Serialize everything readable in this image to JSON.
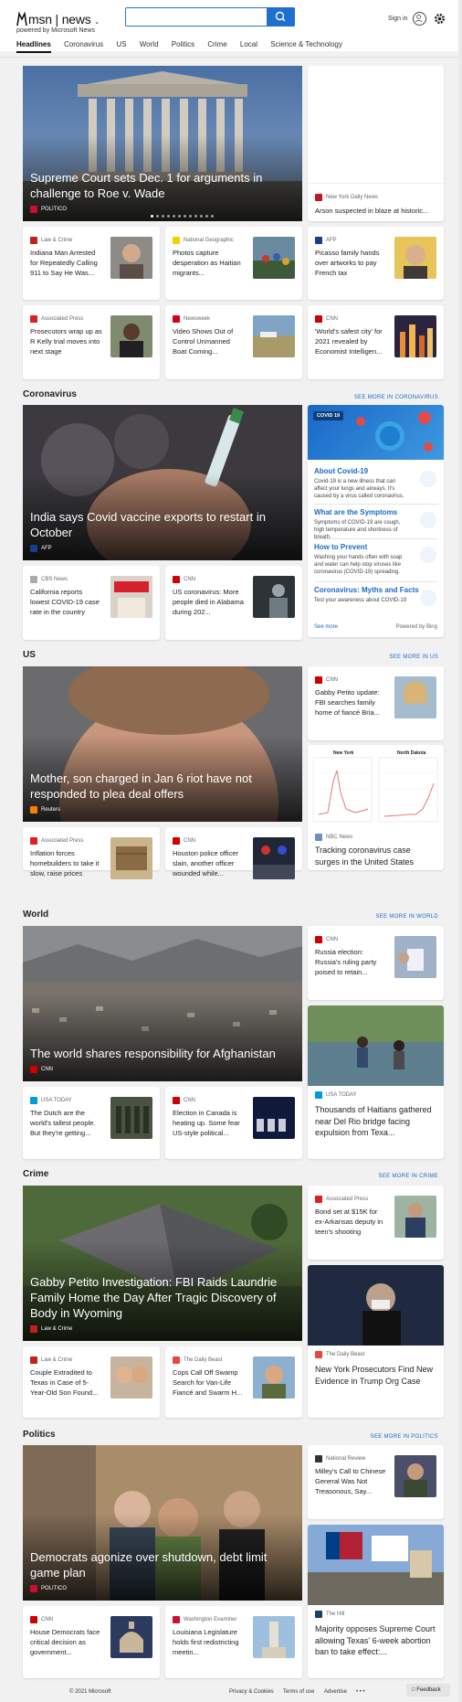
{
  "header": {
    "brand": "msn",
    "section": "news",
    "powered_by": "powered by Microsoft News",
    "search_placeholder": "",
    "signin_label": "Sign in"
  },
  "nav": {
    "items": [
      "Headlines",
      "Coronavirus",
      "US",
      "World",
      "Politics",
      "Crime",
      "Local",
      "Science & Technology"
    ]
  },
  "headlines": {
    "hero": {
      "title": "Supreme Court sets Dec. 1 for arguments in challenge to Roe v. Wade",
      "source": "POLITICO"
    },
    "side_card": {
      "source": "New York Daily News",
      "title": "Arson suspected in blaze at historic..."
    },
    "cards": [
      {
        "source": "Law & Crime",
        "title": "Indiana Man Arrested for Repeatedly Calling 911 to Say He Was..."
      },
      {
        "source": "National Geographic",
        "title": "Photos capture desperation as Haitian migrants..."
      },
      {
        "source": "AFP",
        "title": "Picasso family hands over artworks to pay French tax"
      },
      {
        "source": "Associated Press",
        "title": "Prosecutors wrap up as R Kelly trial moves into next stage"
      },
      {
        "source": "Newsweek",
        "title": "Video Shows Out of Control Unmanned Boat Coming..."
      },
      {
        "source": "CNN",
        "title": "'World's safest city' for 2021 revealed by Economist Intelligen..."
      }
    ]
  },
  "coronavirus": {
    "section_title": "Coronavirus",
    "see_more": "SEE MORE IN CORONAVIRUS",
    "hero": {
      "title": "India says Covid vaccine exports to restart in October",
      "source": "AFP"
    },
    "cards": [
      {
        "source": "CBS News",
        "title": "California reports lowest COVID-19 case rate in the country"
      },
      {
        "source": "CNN",
        "title": "US coronavirus: More people died in Alabama during 202..."
      }
    ],
    "panel": {
      "tag": "COVID 19",
      "items": [
        {
          "heading": "About Covid-19",
          "desc": "Covid-19 is a new illness that can affect your lungs and airways. It's caused by a virus called coronavirus."
        },
        {
          "heading": "What are the Symptoms",
          "desc": "Symptoms of COVID-19 are cough, high temperature and shortness of breath."
        },
        {
          "heading": "How to Prevent",
          "desc": "Washing your hands often with soap and water can help stop viruses like coronavirus (COVID-19) spreading."
        },
        {
          "heading": "Coronavirus: Myths and Facts",
          "desc": "Test your awareness about COVID-19"
        }
      ],
      "see_more": "See more",
      "powered": "Powered by Bing"
    }
  },
  "us": {
    "section_title": "US",
    "see_more": "SEE MORE IN US",
    "hero": {
      "title": "Mother, son charged in Jan 6 riot have not responded to plea deal offers",
      "source": "Reuters"
    },
    "side_card": {
      "source": "CNN",
      "title": "Gabby Petito update: FBI searches family home of fiancé Bria..."
    },
    "chart_card": {
      "labels": [
        "New York",
        "North Dakota"
      ],
      "source": "NBC News",
      "title": "Tracking coronavirus case surges in the United States"
    },
    "cards": [
      {
        "source": "Associated Press",
        "title": "Inflation forces homebuilders to take it slow, raise prices"
      },
      {
        "source": "CNN",
        "title": "Houston police officer slain, another officer wounded while..."
      }
    ]
  },
  "world": {
    "section_title": "World",
    "see_more": "SEE MORE IN WORLD",
    "hero": {
      "title": "The world shares responsibility for Afghanistan",
      "source": "CNN"
    },
    "side_card": {
      "source": "CNN",
      "title": "Russia election: Russia's ruling party poised to retain..."
    },
    "big_card": {
      "source": "USA TODAY",
      "title": "Thousands of Haitians gathered near Del Rio bridge facing expulsion from Texa..."
    },
    "cards": [
      {
        "source": "USA TODAY",
        "title": "The Dutch are the world's tallest people. But they're getting..."
      },
      {
        "source": "CNN",
        "title": "Election in Canada is heating up. Some fear US-style political..."
      }
    ]
  },
  "crime": {
    "section_title": "Crime",
    "see_more": "SEE MORE IN CRIME",
    "hero": {
      "title": "Gabby Petito Investigation: FBI Raids Laundrie Family Home the Day After Tragic Discovery of Body in Wyoming",
      "source": "Law & Crime"
    },
    "side_card": {
      "source": "Associated Press",
      "title": "Bond set at $15K for ex-Arkansas deputy in teen's shooting"
    },
    "big_card": {
      "source": "The Daily Beast",
      "title": "New York Prosecutors Find New Evidence in Trump Org Case"
    },
    "cards": [
      {
        "source": "Law & Crime",
        "title": "Couple Extradited to Texas in Case of 5-Year-Old Son Found..."
      },
      {
        "source": "The Daily Beast",
        "title": "Cops Call Off Swamp Search for Van-Life Fiancé and Swarm H..."
      }
    ]
  },
  "politics": {
    "section_title": "Politics",
    "see_more": "SEE MORE IN POLITICS",
    "hero": {
      "title": "Democrats agonize over shutdown, debt limit game plan",
      "source": "POLITICO"
    },
    "side_card": {
      "source": "National Review",
      "title": "Milley's Call to Chinese General Was Not Treasonous, Say..."
    },
    "big_card": {
      "source": "The Hill",
      "title": "Majority opposes Supreme Court allowing Texas' 6-week abortion ban to take effect:..."
    },
    "cards": [
      {
        "source": "CNN",
        "title": "House Democrats face critical decision as government..."
      },
      {
        "source": "Washington Examiner",
        "title": "Louisiana Legislature holds first redistricting meetin..."
      }
    ]
  },
  "footer": {
    "copyright": "© 2021 Microsoft",
    "privacy": "Privacy & Cookies",
    "terms": "Terms of use",
    "advertise": "Advertise",
    "more": "• • •",
    "feedback": "Feedback"
  },
  "colors": {
    "accent": "#1b6ac9",
    "search_button": "#1f6fd1",
    "cnn": "#cc0000",
    "politico": "#c8102e"
  }
}
